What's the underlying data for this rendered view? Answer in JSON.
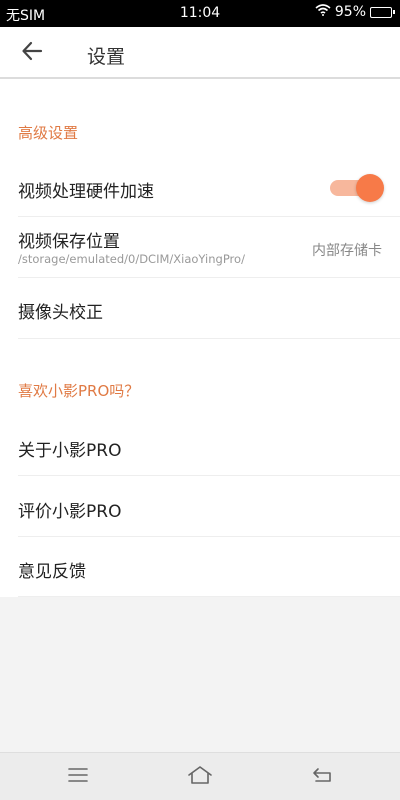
{
  "status_bar": {
    "carrier": "无SIM",
    "time": "11:04",
    "battery_percent": "95%",
    "wifi_icon": "wifi-icon",
    "battery_icon": "battery-icon"
  },
  "app_bar": {
    "back_icon": "arrow-left-icon",
    "title": "设置"
  },
  "sections": {
    "advanced": {
      "header": "高级设置",
      "hardware_accel_label": "视频处理硬件加速",
      "hardware_accel_enabled": true,
      "save_location_label": "视频保存位置",
      "save_location_path": "/storage/emulated/0/DCIM/XiaoYingPro/",
      "save_location_value": "内部存储卡",
      "camera_calibration_label": "摄像头校正"
    },
    "like": {
      "header": "喜欢小影PRO吗？",
      "about_label": "关于小影PRO",
      "rate_label": "评价小影PRO",
      "feedback_label": "意见反馈"
    }
  },
  "nav_bar": {
    "menu_icon": "menu-icon",
    "home_icon": "home-icon",
    "back_icon": "back-icon"
  },
  "colors": {
    "accent": "#e07a44",
    "toggle_knob": "#f77a48",
    "toggle_track": "#f7b79c"
  }
}
